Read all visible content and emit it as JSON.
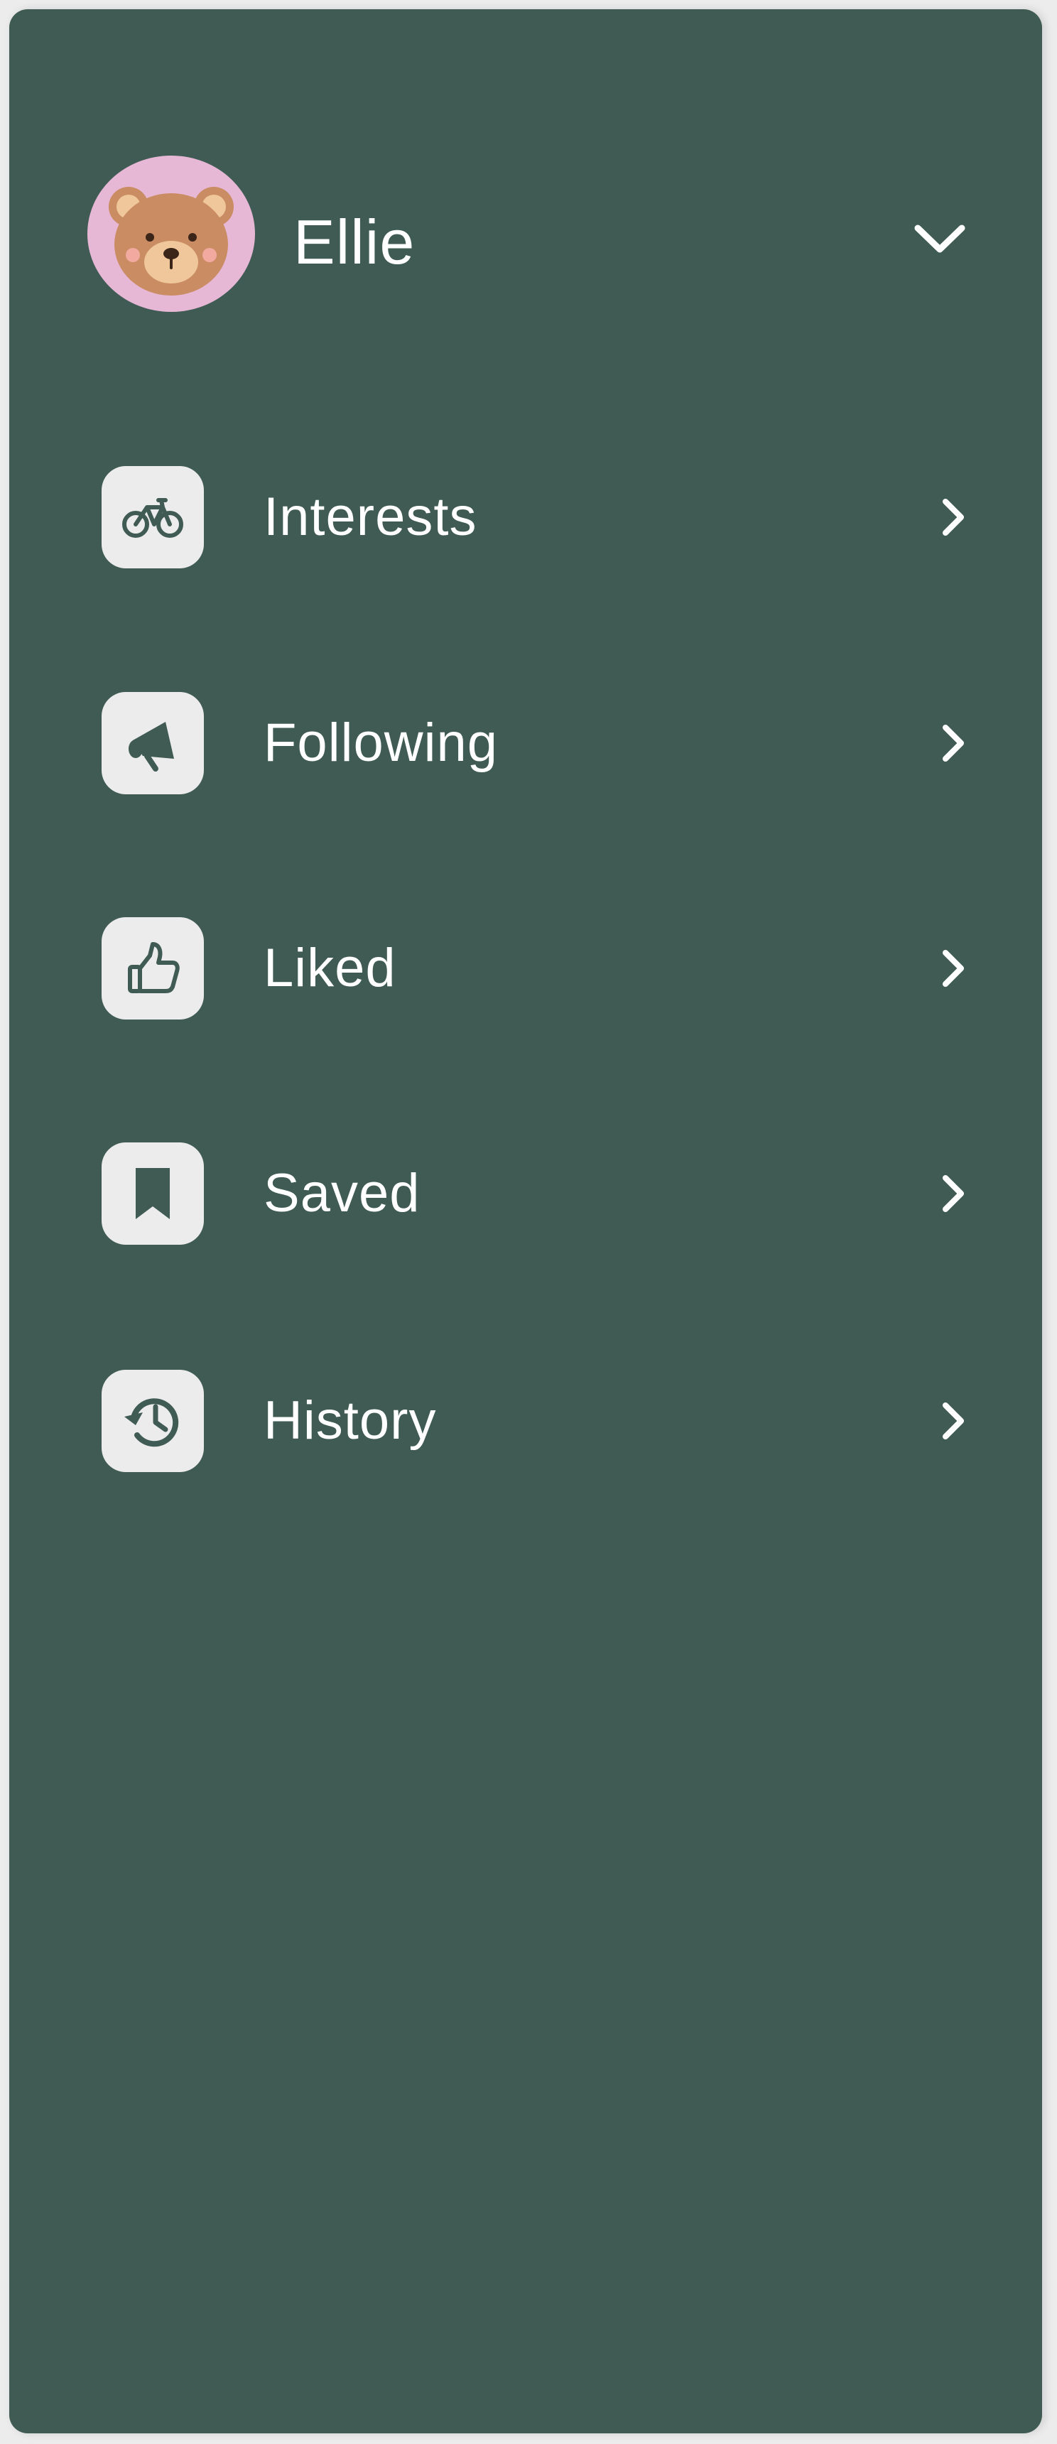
{
  "profile": {
    "name": "Ellie",
    "avatar_icon": "teddy-bear-avatar",
    "toggle_icon": "chevron-down-icon"
  },
  "menu": {
    "items": [
      {
        "label": "Interests",
        "icon": "bicycle-icon"
      },
      {
        "label": "Following",
        "icon": "megaphone-icon"
      },
      {
        "label": "Liked",
        "icon": "thumbs-up-icon"
      },
      {
        "label": "Saved",
        "icon": "bookmark-icon"
      },
      {
        "label": "History",
        "icon": "history-icon"
      }
    ],
    "chevron_icon": "chevron-right-icon"
  },
  "colors": {
    "drawer_background": "#3f5b53",
    "icon_tile": "#ececec",
    "icon_glyph": "#3f5b53",
    "avatar_background": "#e7b8d6",
    "text": "#ffffff"
  }
}
